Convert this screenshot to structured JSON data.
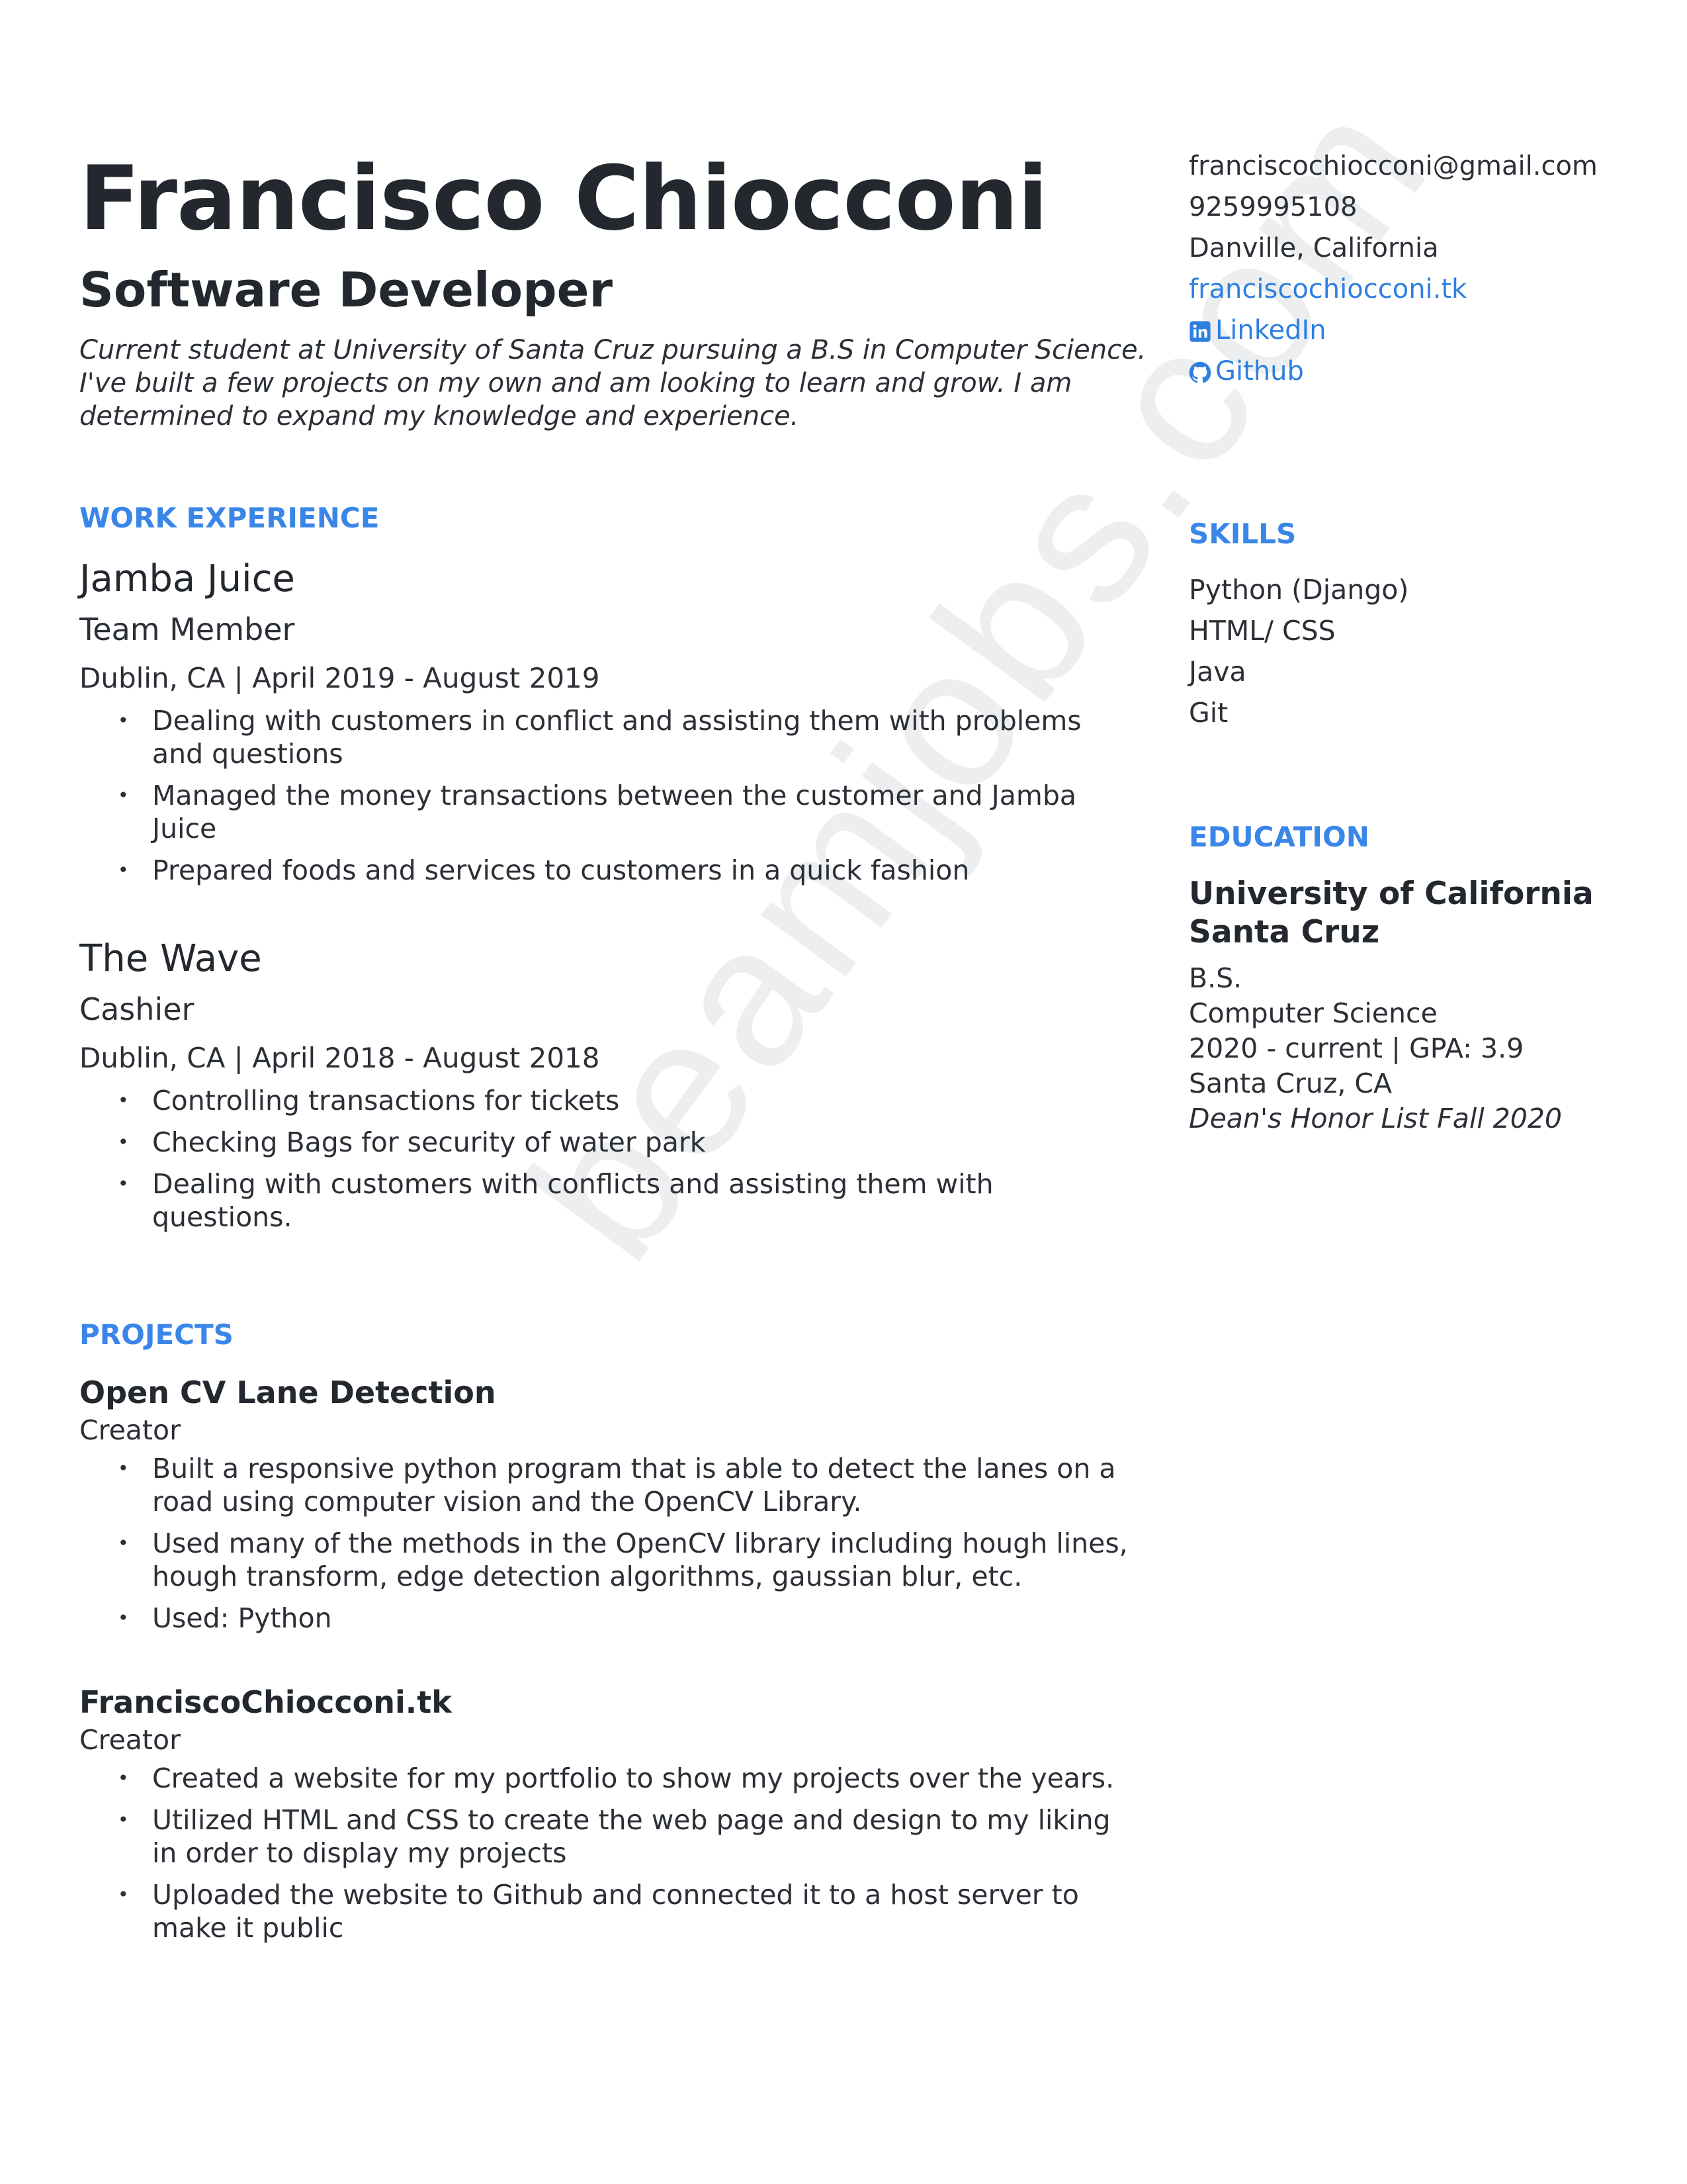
{
  "watermark": "beamjobs.com",
  "header": {
    "name": "Francisco Chiocconi",
    "title": "Software Developer",
    "summary": "Current student at University of Santa Cruz pursuing a B.S in Computer Science. I've built a few projects on my own and am looking to learn and grow. I am determined to expand my knowledge and experience."
  },
  "contact": {
    "email": "franciscochiocconi@gmail.com",
    "phone": "9259995108",
    "location": "Danville, California",
    "website": "franciscochiocconi.tk",
    "linkedin": "LinkedIn",
    "github": "Github",
    "linkedin_icon": "linkedin-icon",
    "github_icon": "github-icon"
  },
  "work": {
    "heading": "WORK EXPERIENCE",
    "jobs": [
      {
        "company": "Jamba Juice",
        "role": "Team Member",
        "meta": "Dublin, CA | April 2019 - August 2019",
        "bullets": [
          "Dealing with customers in conflict and assisting them with problems and questions",
          "Managed the money transactions between the customer and Jamba Juice",
          "Prepared foods and services to customers in a quick fashion"
        ]
      },
      {
        "company": "The Wave",
        "role": "Cashier",
        "meta": "Dublin, CA | April 2018 - August 2018",
        "bullets": [
          "Controlling transactions for tickets",
          "Checking Bags for security of water park",
          "Dealing with customers with conflicts and assisting them with questions."
        ]
      }
    ]
  },
  "projects": {
    "heading": "PROJECTS",
    "items": [
      {
        "title": "Open CV Lane Detection",
        "role": "Creator",
        "bullets": [
          "Built a responsive python program that is able to detect the lanes on a road using computer vision and the OpenCV Library.",
          "Used many of the methods in the OpenCV library including hough lines, hough transform, edge detection algorithms, gaussian blur, etc.",
          "Used: Python"
        ]
      },
      {
        "title": "FranciscoChiocconi.tk",
        "role": "Creator",
        "bullets": [
          "Created a website for my portfolio to show my projects over the years.",
          "Utilized HTML and CSS to create the web page and design to my liking in order to display my projects",
          "Uploaded the website to Github and connected it to a host server to make it public"
        ]
      }
    ]
  },
  "skills": {
    "heading": "SKILLS",
    "items": [
      "Python (Django)",
      "HTML/ CSS",
      "Java",
      "Git"
    ]
  },
  "education": {
    "heading": "EDUCATION",
    "school": "University of California Santa Cruz",
    "degree": "B.S.",
    "field": "Computer Science",
    "dates": "2020 - current | GPA: 3.9",
    "location": "Santa Cruz, CA",
    "honors": "Dean's Honor List Fall 2020"
  },
  "colors": {
    "accent": "#3a86e8",
    "link": "#2f7fe0",
    "text": "#2b2f36"
  }
}
